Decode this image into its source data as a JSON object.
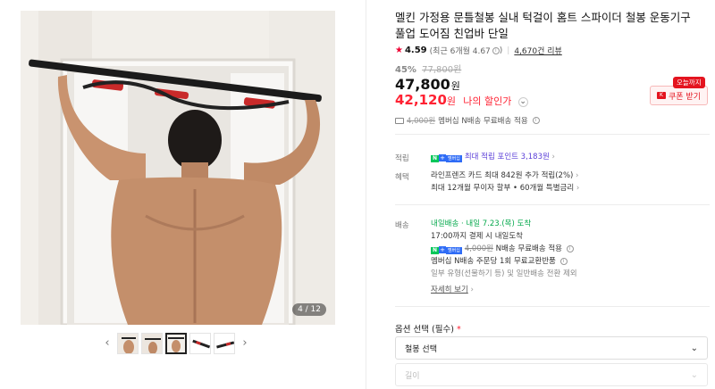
{
  "gallery": {
    "page_counter": "4 / 12",
    "prev_arrow": "‹",
    "next_arrow": "›",
    "thumbnail_count": 5,
    "active_thumbnail": 3
  },
  "product": {
    "title": "멜킨 가정용 문틀철봉 실내 턱걸이 홈트 스파이더 철봉 운동기구 풀업 도어짐 친업바 단일",
    "rating": {
      "star": "★",
      "score": "4.59",
      "recent": "(최근 6개월 4.67",
      "recent_close": ")",
      "reviews": "4,670건 리뷰"
    },
    "discount_percent": "45%",
    "original_price": "77,800원",
    "price": "47,800",
    "price_unit": "원",
    "my_sale_price": "42,120",
    "my_sale_unit": "원",
    "my_sale_label": "나의 할인가",
    "coupon_badge": "오늘까지",
    "coupon_button": "쿠폰 받기",
    "shipping_strike": "4,000원",
    "shipping_text": "멤버십 N배송 무료배송 적용"
  },
  "benefits": {
    "points_label": "적립",
    "points_text": "최대 적립 포인트 3,183원",
    "benefit_label": "혜택",
    "benefit_line1": "라인프렌즈 카드 최대 842원 추가 적립(2%)",
    "benefit_line2": "최대 12개월 무이자 할부 • 60개월 특별금리"
  },
  "delivery": {
    "label": "배송",
    "badge": "내일배송",
    "eta": "· 내일 7.23.(목) 도착",
    "cutoff": "17:00까지 결제 시 내일도착",
    "fee_strike": "4,000원",
    "fee_text": "N배송 무료배송 적용",
    "member_text": "멤버십 N배송 주문당 1회 무료교환반품",
    "exclude_text": "일부 유형(선물하기 등) 및 일반배송 전환 제외",
    "detail_link": "자세히 보기"
  },
  "options": {
    "title": "옵션 선택",
    "required": "(필수)",
    "required_mark": "*",
    "select1": "철봉 선택",
    "select2": "길이"
  },
  "icons": {
    "gt": "›",
    "chevron_down": "⌄",
    "info": "i",
    "npay_n": "N",
    "npay_plus": "+",
    "npay_member": "멤버십"
  }
}
